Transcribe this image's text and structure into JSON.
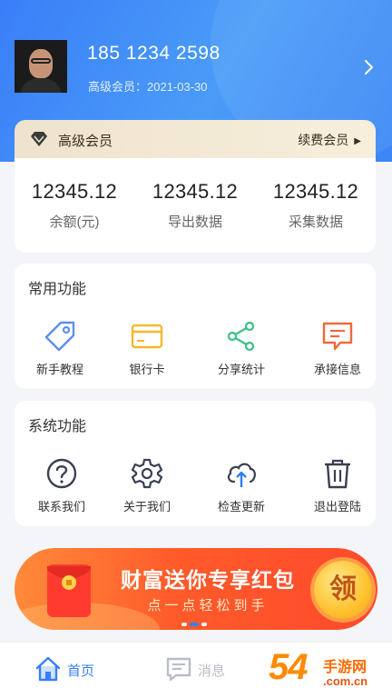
{
  "profile": {
    "phone": "185 1234 2598",
    "member_since": "高级会员：2021-03-30"
  },
  "vip": {
    "label": "高级会员",
    "renew": "续费会员"
  },
  "stats": [
    {
      "value": "12345.12",
      "label": "余额(元)"
    },
    {
      "value": "12345.12",
      "label": "导出数据"
    },
    {
      "value": "12345.12",
      "label": "采集数据"
    }
  ],
  "common": {
    "title": "常用功能",
    "items": [
      {
        "label": "新手教程",
        "icon": "tag-icon"
      },
      {
        "label": "银行卡",
        "icon": "bank-card-icon"
      },
      {
        "label": "分享统计",
        "icon": "share-icon"
      },
      {
        "label": "承接信息",
        "icon": "message-icon"
      }
    ]
  },
  "system": {
    "title": "系统功能",
    "items": [
      {
        "label": "联系我们",
        "icon": "question-icon"
      },
      {
        "label": "关于我们",
        "icon": "gear-icon"
      },
      {
        "label": "检查更新",
        "icon": "cloud-upload-icon"
      },
      {
        "label": "退出登陆",
        "icon": "trash-icon"
      }
    ]
  },
  "banner": {
    "title": "财富送你专享红包",
    "subtitle": "点一点轻松到手",
    "coin": "领"
  },
  "tabs": [
    {
      "label": "首页",
      "icon": "home-icon",
      "active": true
    },
    {
      "label": "消息",
      "icon": "chat-icon",
      "active": false
    }
  ],
  "watermark": {
    "digits": "54"
  },
  "colors": {
    "primary": "#3a7ef8",
    "tag": "#5b8ff0",
    "card": "#f5b82e",
    "share": "#3cbf86",
    "message": "#ef6a3a",
    "inactive": "#b8bcc8"
  }
}
